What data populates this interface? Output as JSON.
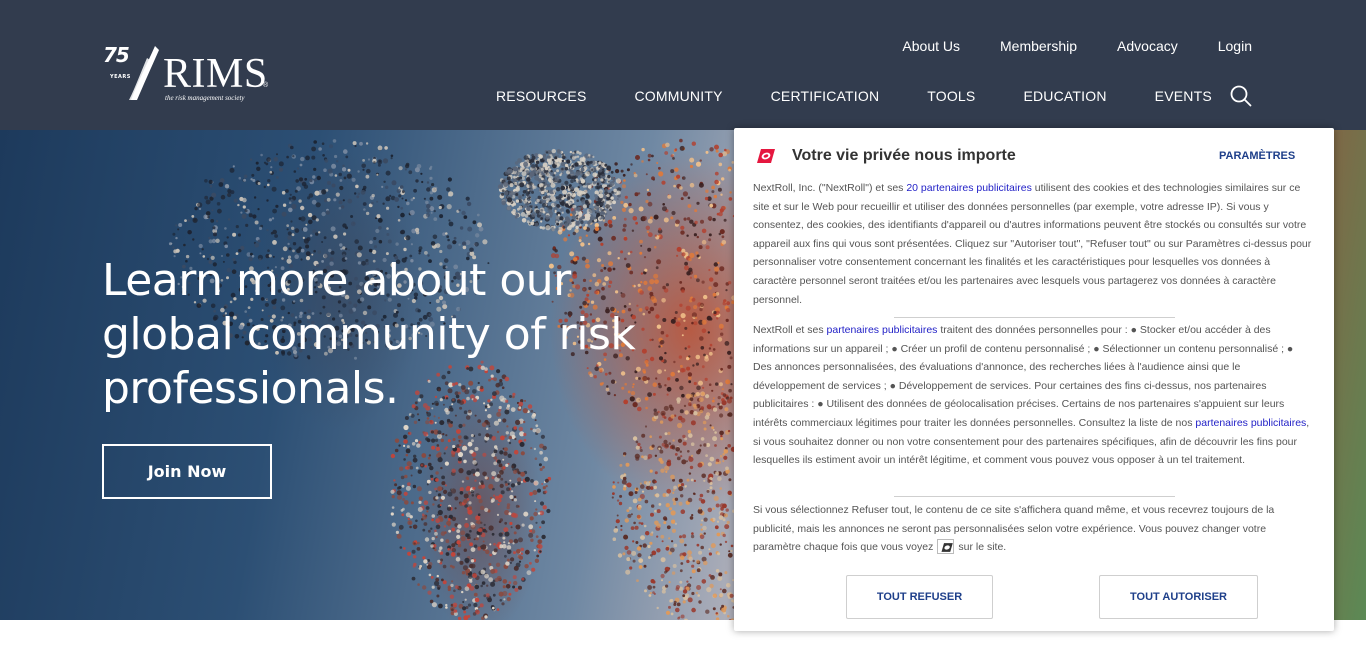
{
  "header": {
    "logo": {
      "years_number": "75",
      "years_label": "YEARS",
      "brand": "RIMS",
      "registered": "®",
      "tagline": "the risk management society"
    },
    "utility_nav": [
      "About Us",
      "Membership",
      "Advocacy",
      "Login"
    ],
    "main_nav": [
      "RESOURCES",
      "COMMUNITY",
      "CERTIFICATION",
      "TOOLS",
      "EDUCATION",
      "EVENTS"
    ],
    "search_icon": "search-icon"
  },
  "hero": {
    "title": "Learn more about our global community of risk professionals.",
    "cta_label": "Join Now"
  },
  "consent": {
    "title": "Votre vie privée nous importe",
    "settings_label": "PARAMÈTRES",
    "p1": {
      "before_link": "NextRoll, Inc. (\"NextRoll\") et ses ",
      "link": "20 partenaires publicitaires",
      "after_link": " utilisent des cookies et des technologies similaires sur ce site et sur le Web pour recueillir et utiliser des données personnelles (par exemple, votre adresse IP). Si vous y consentez, des cookies, des identifiants d'appareil ou d'autres informations peuvent être stockés ou consultés sur votre appareil aux fins qui vous sont présentées. Cliquez sur \"Autoriser tout\", \"Refuser tout\" ou sur Paramètres ci-dessus pour personnaliser votre consentement concernant les finalités et les caractéristiques pour lesquelles vos données à caractère personnel seront traitées et/ou les partenaires avec lesquels vous partagerez vos données à caractère personnel."
    },
    "p2": {
      "before_link": "NextRoll et ses ",
      "link": "partenaires publicitaires",
      "middle": " traitent des données personnelles pour : ● Stocker et/ou accéder à des informations sur un appareil ; ● Créer un profil de contenu personnalisé ; ● Sélectionner un contenu personnalisé ; ● Des annonces personnalisées, des évaluations d'annonce, des recherches liées à l'audience ainsi que le développement de services ; ● Développement de services. Pour certaines des fins ci-dessus, nos partenaires publicitaires : ● Utilisent des données de géolocalisation précises. Certains de nos partenaires s'appuient sur leurs intérêts commerciaux légitimes pour traiter les données personnelles. Consultez la liste de nos ",
      "link2": "partenaires publicitaires",
      "after_link": ", si vous souhaitez donner ou non votre consentement pour des partenaires spécifiques, afin de découvrir les fins pour lesquelles ils estiment avoir un intérêt légitime, et comment vous pouvez vous opposer à un tel traitement."
    },
    "p3": {
      "before_icon": "Si vous sélectionnez Refuser tout, le contenu de ce site s'affichera quand même, et vous recevrez toujours de la publicité, mais les annonces ne seront pas personnalisées selon votre expérience. Vous pouvez changer votre paramètre chaque fois que vous voyez",
      "after_icon": "sur le site."
    },
    "refuse_label": "TOUT REFUSER",
    "accept_label": "TOUT AUTORISER",
    "brand_color": "#e5173f",
    "link_color": "#2322c7",
    "button_text_color": "#1e3f8a"
  }
}
